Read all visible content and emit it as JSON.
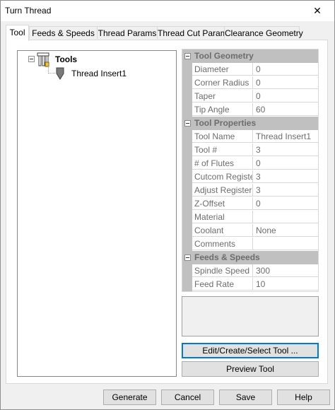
{
  "window": {
    "title": "Turn Thread"
  },
  "tabs": [
    {
      "label": "Tool",
      "active": true
    },
    {
      "label": "Feeds & Speeds"
    },
    {
      "label": "Thread Params"
    },
    {
      "label": "Thread Cut Params"
    },
    {
      "label": "Clearance Geometry"
    }
  ],
  "tree": {
    "root": {
      "label": "Tools",
      "icon": "tool-holder-icon"
    },
    "child": {
      "label": "Thread Insert1",
      "icon": "thread-insert-icon"
    }
  },
  "properties": {
    "tool_geometry": {
      "title": "Tool Geometry",
      "rows": [
        {
          "name": "Diameter",
          "value": "0"
        },
        {
          "name": "Corner Radius",
          "value": "0"
        },
        {
          "name": "Taper",
          "value": "0"
        },
        {
          "name": "Tip Angle",
          "value": "60"
        }
      ]
    },
    "tool_properties": {
      "title": "Tool Properties",
      "rows": [
        {
          "name": "Tool Name",
          "value": "Thread Insert1"
        },
        {
          "name": "Tool #",
          "value": "3"
        },
        {
          "name": "# of Flutes",
          "value": "0"
        },
        {
          "name": "Cutcom Registe",
          "value": "3"
        },
        {
          "name": "Adjust Register",
          "value": "3"
        },
        {
          "name": "Z-Offset",
          "value": "0"
        },
        {
          "name": "Material",
          "value": ""
        },
        {
          "name": "Coolant",
          "value": "None"
        },
        {
          "name": "Comments",
          "value": ""
        }
      ]
    },
    "feeds_speeds": {
      "title": "Feeds & Speeds",
      "rows": [
        {
          "name": "Spindle Speed",
          "value": "300"
        },
        {
          "name": "Feed Rate",
          "value": "10"
        }
      ]
    }
  },
  "buttons": {
    "edit_tool": "Edit/Create/Select Tool ...",
    "preview_tool": "Preview Tool",
    "generate": "Generate",
    "cancel": "Cancel",
    "save": "Save",
    "help": "Help"
  },
  "icons": {
    "close": "close-icon"
  },
  "colors": {
    "focus_border": "#0078d7",
    "grid_margin": "#c0c0c0"
  }
}
